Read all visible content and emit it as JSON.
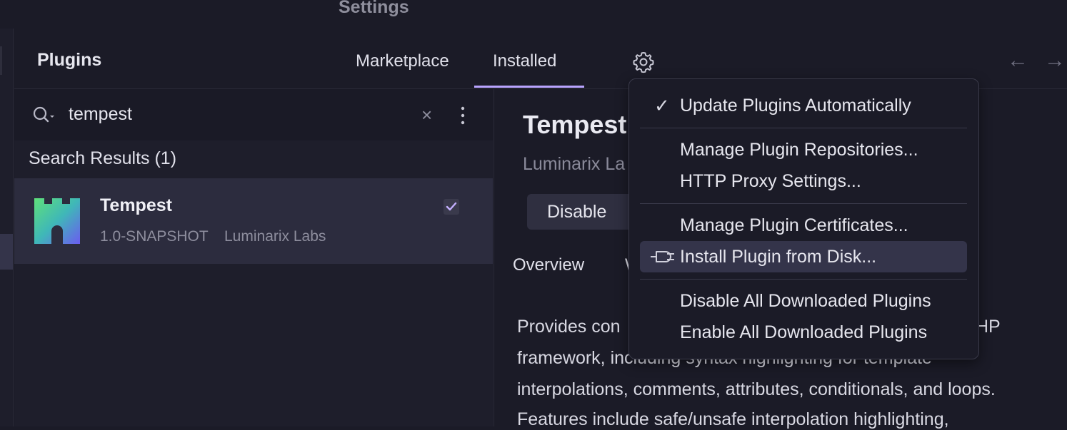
{
  "window": {
    "title": "Settings"
  },
  "header": {
    "title": "Plugins",
    "tabs": [
      {
        "label": "Marketplace",
        "active": false
      },
      {
        "label": "Installed",
        "active": true
      }
    ],
    "back_arrow": "←",
    "forward_arrow": "→",
    "icons": {
      "settings": "gear-icon"
    }
  },
  "search": {
    "value": "tempest",
    "placeholder": "",
    "clear_glyph": "×"
  },
  "results": {
    "label": "Search Results (1)",
    "items": [
      {
        "name": "Tempest",
        "version": "1.0-SNAPSHOT",
        "vendor": "Luminarix Labs",
        "enabled": true
      }
    ]
  },
  "detail": {
    "title": "Tempest",
    "vendor": "Luminarix La",
    "disable_label": "Disable",
    "tabs": [
      "Overview",
      "W"
    ],
    "description_lines": [
      "Provides con",
      "HP",
      "framework, including syntax highlighting for template",
      "interpolations, comments, attributes, conditionals, and loops.",
      "Features include safe/unsafe interpolation highlighting,"
    ]
  },
  "menu": {
    "check_glyph": "✓",
    "items": [
      "Update Plugins Automatically",
      "Manage Plugin Repositories...",
      "HTTP Proxy Settings...",
      "Manage Plugin Certificates...",
      "Install Plugin from Disk...",
      "Disable All Downloaded Plugins",
      "Enable All Downloaded Plugins"
    ]
  },
  "colors": {
    "accent": "#b9a4ff",
    "background": "#1b1b27",
    "selected_row": "#2c2c3e"
  }
}
